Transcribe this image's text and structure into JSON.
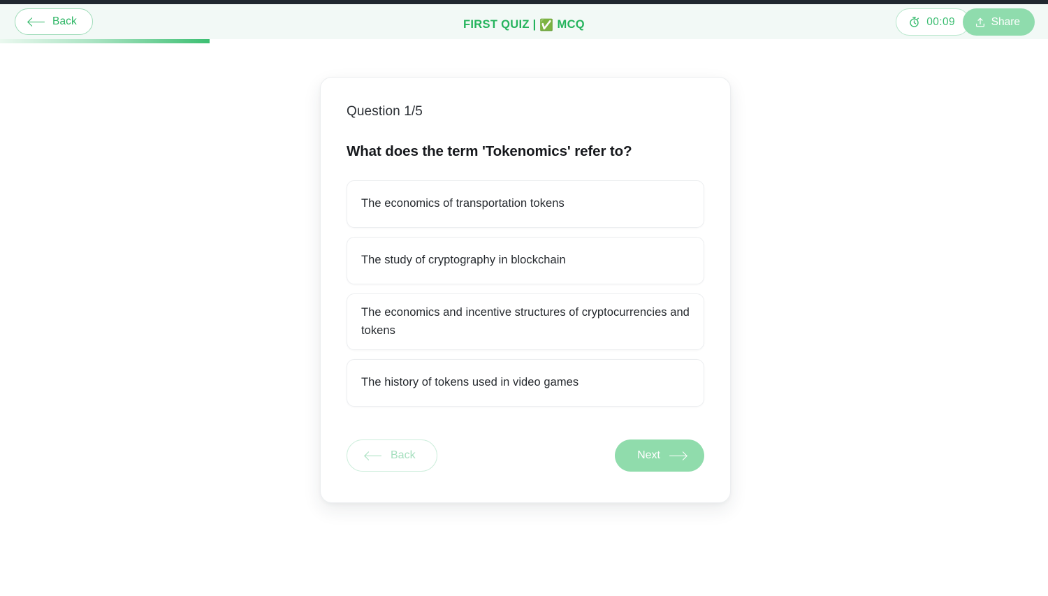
{
  "header": {
    "back_label": "Back",
    "title_main": "FIRST QUIZ |",
    "title_check": "✅",
    "title_type": "MCQ",
    "timer": "00:09",
    "share_label": "Share",
    "accent_color": "#24b35c",
    "band_color": "#f2f9f6"
  },
  "progress": {
    "percent": 20,
    "gradient_from": "#eaf8ef",
    "gradient_to": "#3cbf72"
  },
  "quiz": {
    "counter": "Question 1/5",
    "question": "What does the term 'Tokenomics' refer to?",
    "options": [
      {
        "label": "The economics of transportation tokens"
      },
      {
        "label": "The study of cryptography in blockchain"
      },
      {
        "label": "The economics and incentive structures of cryptocurrencies and tokens"
      },
      {
        "label": "The history of tokens used in video games"
      }
    ],
    "nav": {
      "back_label": "Back",
      "next_label": "Next",
      "back_disabled": true,
      "next_disabled": true,
      "next_color": "#90dcac"
    }
  }
}
